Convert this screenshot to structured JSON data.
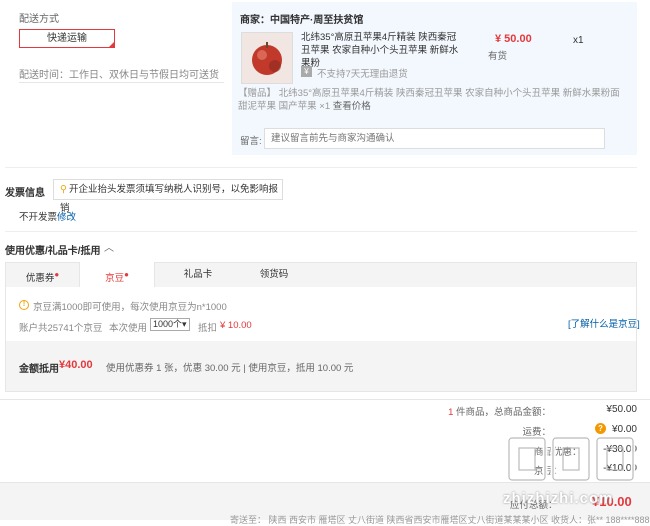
{
  "delivery": {
    "title": "配送方式",
    "method_button": "快递运输",
    "time": "配送时间：工作日、双休日与节假日均可送货"
  },
  "merchant": {
    "label": "商家：中国特产·周至扶贫馆",
    "product": {
      "title": "北纬35°高原丑苹果4斤精装 陕西秦冠丑苹果 农家自种小个头丑苹果 新鲜水果粉",
      "price": "¥ 50.00",
      "stock": "有货",
      "qty": "x1",
      "return_policy_icon": "¥",
      "return_policy": "不支持7天无理由退货"
    },
    "gift_prefix": "【赠品】",
    "gift_text": " 北纬35°高原丑苹果4斤精装 陕西秦冠丑苹果 农家自种小个头丑苹果 新鲜水果粉面甜泥苹果 国产苹果 ×1 ",
    "gift_link": "查看价格",
    "memo_label": "留言:",
    "memo_placeholder": "建议留言前先与商家沟通确认"
  },
  "invoice": {
    "title": "发票信息",
    "tip": "开企业抬头发票须填写纳税人识别号，以免影响报销",
    "current": "不开发票",
    "edit": "修改"
  },
  "coupons": {
    "title": "使用优惠/礼品卡/抵用",
    "arrow": "︿",
    "tabs": [
      {
        "label": "优惠券",
        "dot": "●"
      },
      {
        "label": "京豆",
        "dot": "●"
      },
      {
        "label": "礼品卡",
        "dot": ""
      },
      {
        "label": "领货码",
        "dot": ""
      }
    ],
    "bean_tip": "京豆满1000即可使用，每次使用京豆为n*1000",
    "bean_account": "账户共25741个京豆",
    "bean_use_label": "本次使用",
    "bean_use_value": "1000个",
    "bean_deduct_label": "抵扣",
    "bean_deduct_amount": "¥ 10.00",
    "bean_link": "[了解什么是京豆]",
    "summary_label": "金额抵用",
    "summary_amount": "¥40.00",
    "summary_detail": "使用优惠券 1 张，优惠 30.00 元   | 使用京豆，抵用 10.00 元"
  },
  "totals": {
    "count": "1",
    "count_suffix": " 件商品，总商品金额：",
    "goods_amount": "¥50.00",
    "shipping_label": "运费：",
    "shipping_amount": "¥0.00",
    "row3_label": "商品优惠：",
    "row3_amount": "-¥30.00",
    "row4_label": "京豆：",
    "row4_amount": "-¥10.00",
    "pay_label": "应付总额：",
    "pay_amount": "¥10.00",
    "address_line": "寄送至：  陕西 西安市 雁塔区 丈八街道 陕西省西安市雁塔区丈八街道某某某小区   收货人：张**  188****8888"
  },
  "watermark": {
    "text": "zhizhizhi.com"
  }
}
